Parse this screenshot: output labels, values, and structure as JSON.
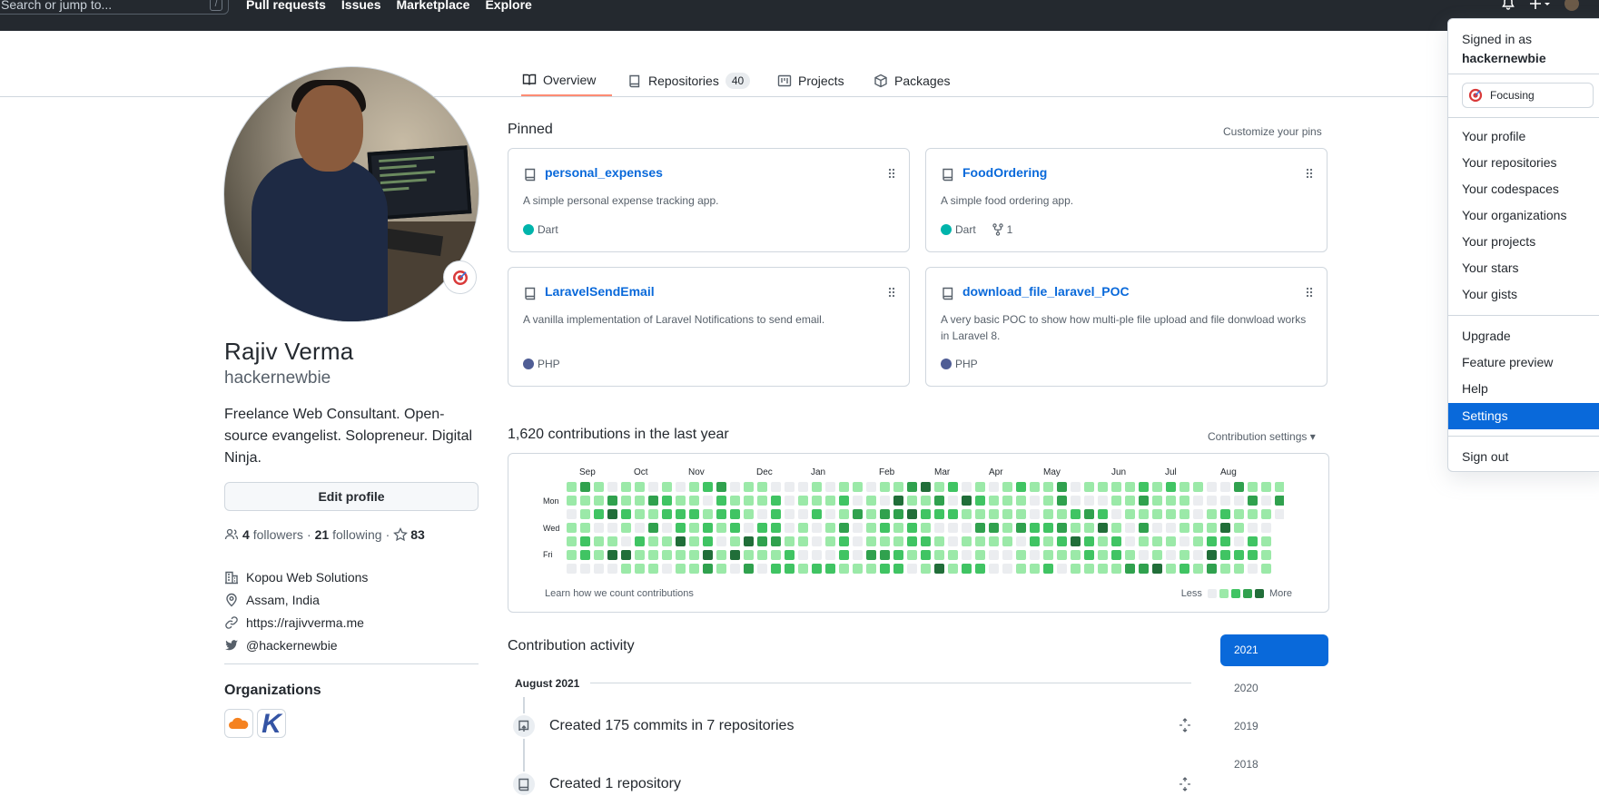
{
  "header": {
    "search_placeholder": "Search or jump to...",
    "search_shortcut": "/",
    "nav": [
      "Pull requests",
      "Issues",
      "Marketplace",
      "Explore"
    ]
  },
  "tabs": [
    {
      "label": "Overview"
    },
    {
      "label": "Repositories",
      "count": "40"
    },
    {
      "label": "Projects"
    },
    {
      "label": "Packages"
    }
  ],
  "profile": {
    "name": "Rajiv Verma",
    "login": "hackernewbie",
    "bio": "Freelance Web Consultant. Open-source evangelist. Solopreneur. Digital Ninja.",
    "edit_label": "Edit profile",
    "followers_count": "4",
    "followers_label": "followers",
    "separator": "·",
    "following_count": "21",
    "following_label": "following",
    "stars_count": "83",
    "company": "Kopou Web Solutions",
    "location": "Assam, India",
    "website": "https://rajivverma.me",
    "twitter": "@hackernewbie",
    "orgs_title": "Organizations",
    "org2_letter": "K"
  },
  "pinned": {
    "title": "Pinned",
    "customize": "Customize your pins",
    "items": [
      {
        "name": "personal_expenses",
        "desc": "A simple personal expense tracking app.",
        "lang": "Dart",
        "lang_color": "#00B4AB"
      },
      {
        "name": "FoodOrdering",
        "desc": "A simple food ordering app.",
        "lang": "Dart",
        "lang_color": "#00B4AB",
        "forks": "1"
      },
      {
        "name": "LaravelSendEmail",
        "desc": "A vanilla implementation of Laravel Notifications to send email.",
        "lang": "PHP",
        "lang_color": "#4F5D95"
      },
      {
        "name": "download_file_laravel_POC",
        "desc": "A very basic POC to show how multi-ple file upload and file donwload works in Laravel 8.",
        "lang": "PHP",
        "lang_color": "#4F5D95"
      }
    ]
  },
  "contributions": {
    "title": "1,620 contributions in the last year",
    "settings": "Contribution settings ▾",
    "months": [
      "Sep",
      "Oct",
      "Nov",
      "Dec",
      "Jan",
      "Feb",
      "Mar",
      "Apr",
      "May",
      "Jun",
      "Jul",
      "Aug"
    ],
    "days": [
      "Mon",
      "Wed",
      "Fri"
    ],
    "learn": "Learn how we count contributions",
    "less": "Less",
    "more": "More",
    "colors": [
      "#ebedf0",
      "#9be9a8",
      "#40c463",
      "#30a14e",
      "#216e39"
    ]
  },
  "activity": {
    "title": "Contribution activity",
    "month": "August 2021",
    "items": [
      {
        "text": "Created 175 commits in 7 repositories"
      },
      {
        "text": "Created 1 repository"
      }
    ],
    "years": [
      "2021",
      "2020",
      "2019",
      "2018"
    ]
  },
  "dropdown": {
    "signed_in_as": "Signed in as",
    "user": "hackernewbie",
    "status": "Focusing",
    "group1": [
      "Your profile",
      "Your repositories",
      "Your codespaces",
      "Your organizations",
      "Your projects",
      "Your stars",
      "Your gists"
    ],
    "group2": [
      "Upgrade",
      "Feature preview",
      "Help",
      "Settings"
    ],
    "signout": "Sign out"
  }
}
